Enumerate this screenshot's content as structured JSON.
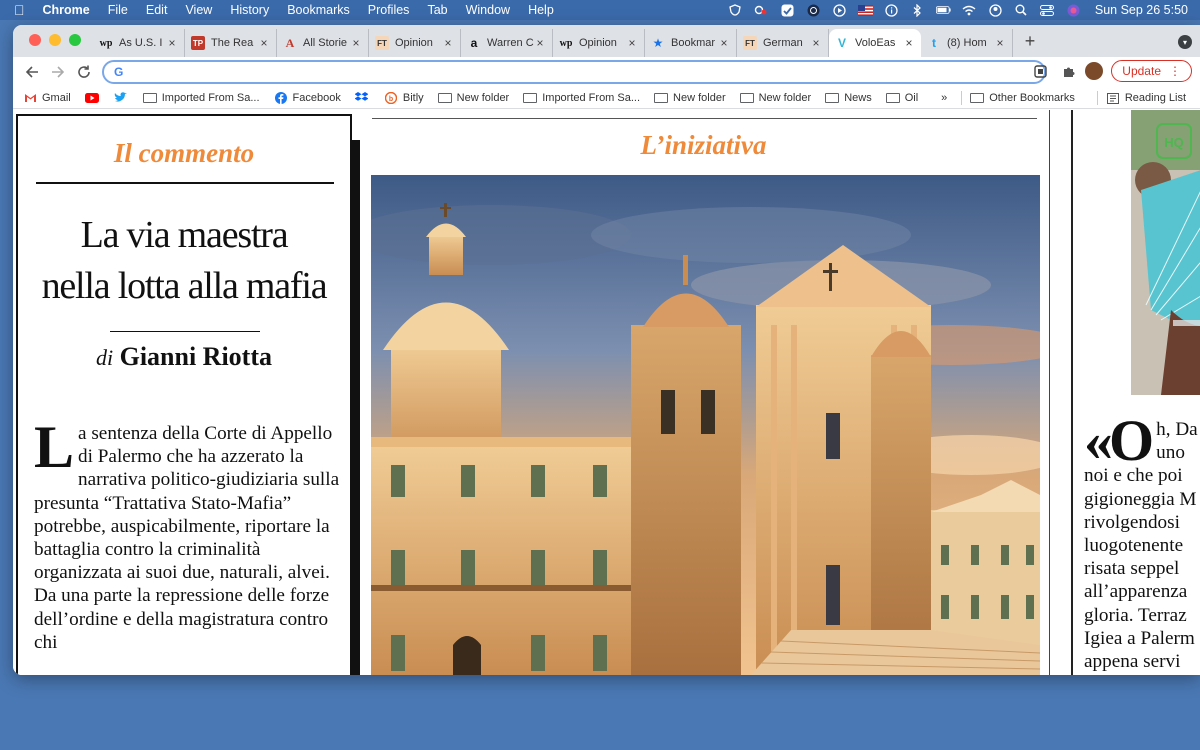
{
  "menubar": {
    "app_name": "Chrome",
    "items": [
      "File",
      "Edit",
      "View",
      "History",
      "Bookmarks",
      "Profiles",
      "Tab",
      "Window",
      "Help"
    ],
    "clock": "Sun Sep 26  5:50"
  },
  "tabs": [
    {
      "favicon": "wp",
      "title": "As U.S. I",
      "active": false
    },
    {
      "favicon": "TP",
      "title": "The Rea",
      "active": false
    },
    {
      "favicon": "A",
      "title": "All Storie",
      "active": false
    },
    {
      "favicon": "FT",
      "title": "Opinion",
      "active": false
    },
    {
      "favicon": "a",
      "title": "Warren C",
      "active": false
    },
    {
      "favicon": "wp",
      "title": "Opinion",
      "active": false
    },
    {
      "favicon": "★",
      "title": "Bookmar",
      "active": false
    },
    {
      "favicon": "FT",
      "title": "German",
      "active": false
    },
    {
      "favicon": "V",
      "title": "VoloEas",
      "active": true
    },
    {
      "favicon": "t",
      "title": "(8) Hom",
      "active": false
    }
  ],
  "toolbar": {
    "omnibox_value": "",
    "update_label": "Update"
  },
  "bookmarks": {
    "items": [
      {
        "icon": "gmail-icon",
        "label": "Gmail"
      },
      {
        "icon": "youtube-icon",
        "label": ""
      },
      {
        "icon": "twitter-icon",
        "label": ""
      },
      {
        "icon": "folder-icon",
        "label": "Imported From Sa..."
      },
      {
        "icon": "facebook-icon",
        "label": "Facebook"
      },
      {
        "icon": "dropbox-icon",
        "label": ""
      },
      {
        "icon": "bitly-icon",
        "label": "Bitly"
      },
      {
        "icon": "folder-icon",
        "label": "New folder"
      },
      {
        "icon": "folder-icon",
        "label": "Imported From Sa..."
      },
      {
        "icon": "folder-icon",
        "label": "New folder"
      },
      {
        "icon": "folder-icon",
        "label": "New folder"
      },
      {
        "icon": "folder-icon",
        "label": "News"
      },
      {
        "icon": "folder-icon",
        "label": "Oil"
      }
    ],
    "overflow": "»",
    "other": "Other Bookmarks",
    "reading_list": "Reading List"
  },
  "page": {
    "left": {
      "section": "Il commento",
      "headline_line1": "La via maestra",
      "headline_line2": "nella lotta alla mafia",
      "byline_di": "di",
      "byline_author": "Gianni Riotta",
      "dropcap": "L",
      "body": "a sentenza della Corte di Appello di Palermo che ha azzerato la narrativa politico-giudiziaria sulla presunta “Trattativa Stato-Mafia” potrebbe, auspicabilmente, riportare la battaglia contro la criminalità organizzata ai suoi due, naturali, alvei. Da una parte la repressione delle forze dell’ordine e della magistratura contro chi"
    },
    "middle": {
      "section": "L’iniziativa"
    },
    "right": {
      "photo_badge": "HQ",
      "quote_cap": "«O",
      "lines": [
        "h, Da",
        "uno",
        "noi e che poi",
        "gigioneggia M",
        "rivolgendosi",
        "luogotenente",
        "risata seppel",
        "all’apparenza",
        "gloria. Terraz",
        "Igiea a Palerm",
        "appena servi"
      ]
    }
  },
  "colors": {
    "accent_orange": "#ee8a3a",
    "desktop_blue": "#4a78b4",
    "update_red": "#d93025"
  }
}
